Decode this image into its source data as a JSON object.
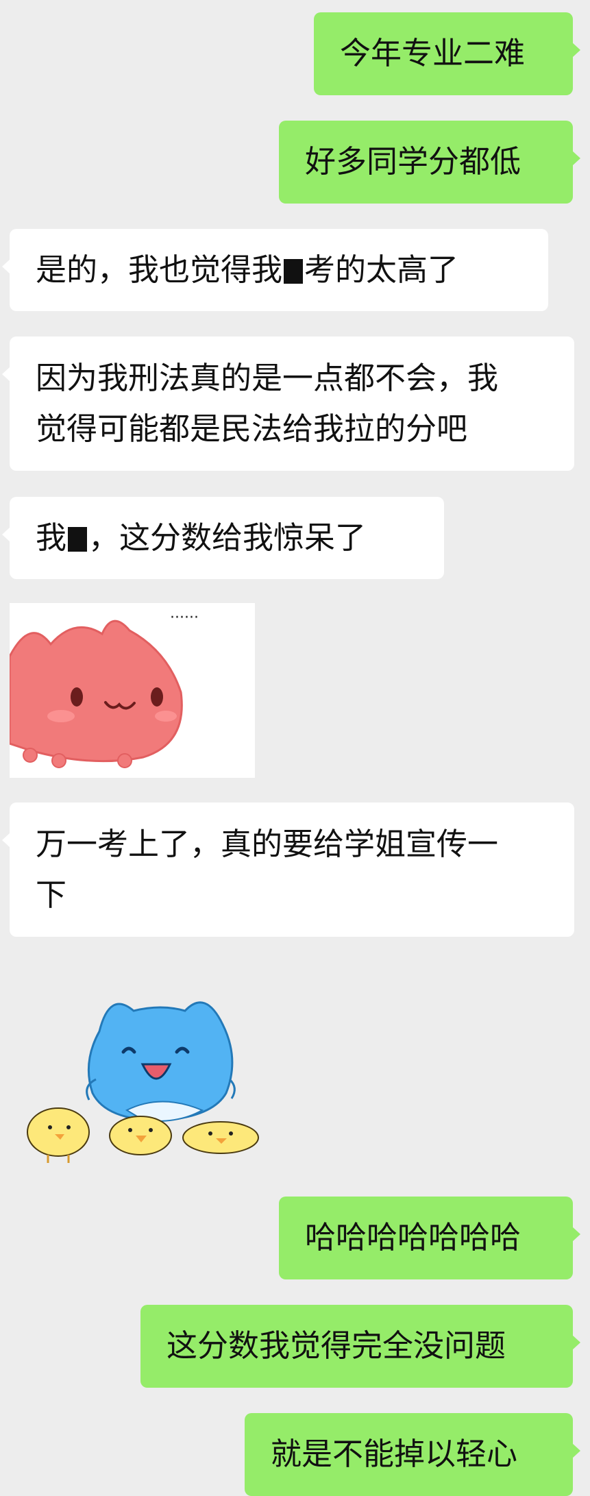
{
  "messages": [
    {
      "side": "out",
      "text": "今年专业二难"
    },
    {
      "side": "out",
      "text": "好多同学分都低"
    },
    {
      "side": "in",
      "before": "是的，我也觉得我",
      "after": "考的太高了"
    },
    {
      "side": "in",
      "line1": "因为我刑法真的是一点都不会，我",
      "line2": "觉得可能都是民法给我拉的分吧"
    },
    {
      "side": "in",
      "before": "我",
      "after": "，这分数给我惊呆了"
    },
    {
      "side": "in",
      "kind": "sticker",
      "sticker": "pink-cat-sticker",
      "caption": "······"
    },
    {
      "side": "in",
      "line1": "万一考上了，真的要给学姐宣传一",
      "line2": "下"
    },
    {
      "side": "in",
      "kind": "sticker",
      "sticker": "blue-cat-with-chicks-sticker"
    },
    {
      "side": "out",
      "text": "哈哈哈哈哈哈哈"
    },
    {
      "side": "out",
      "text": "这分数我觉得完全没问题"
    },
    {
      "side": "out",
      "text": "就是不能掉以轻心"
    }
  ],
  "colors": {
    "background": "#ededed",
    "outgoing_bubble": "#95ec69",
    "incoming_bubble": "#ffffff"
  }
}
